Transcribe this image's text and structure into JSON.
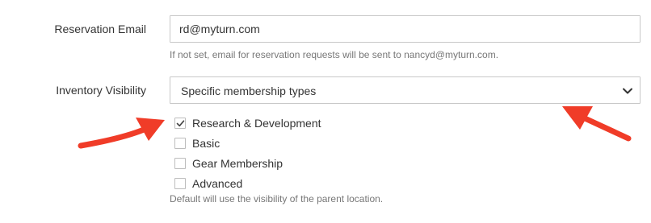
{
  "reservation_email": {
    "label": "Reservation Email",
    "value": "rd@myturn.com",
    "help": "If not set, email for reservation requests will be sent to nancyd@myturn.com."
  },
  "inventory_visibility": {
    "label": "Inventory Visibility",
    "selected": "Specific membership types",
    "options": [
      {
        "label": "Research & Development",
        "checked": true
      },
      {
        "label": "Basic",
        "checked": false
      },
      {
        "label": "Gear Membership",
        "checked": false
      },
      {
        "label": "Advanced",
        "checked": false
      }
    ],
    "help": "Default will use the visibility of the parent location."
  },
  "icons": {
    "select_chevron": "chevron-down-icon",
    "checkbox_check": "check-icon",
    "annotation": "red-arrow"
  },
  "colors": {
    "arrow": "#f03c28",
    "border": "#c8c8c8",
    "help_text": "#777777"
  }
}
